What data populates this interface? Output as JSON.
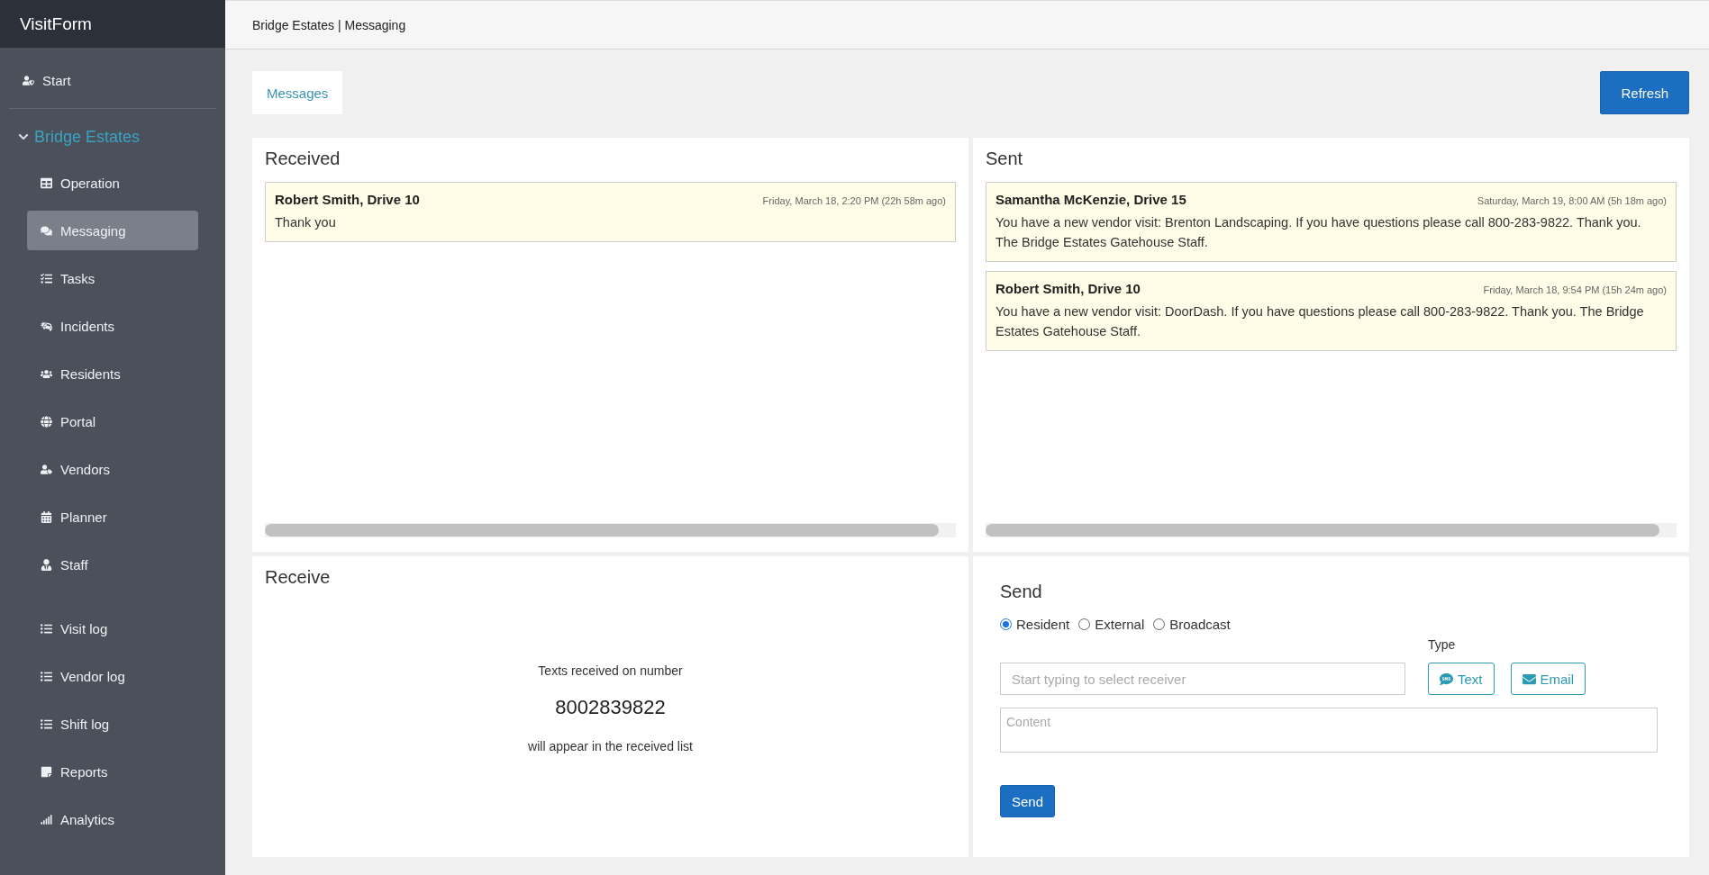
{
  "sidebar": {
    "brand": "VisitForm",
    "start_item": {
      "label": "Start",
      "selected": false
    },
    "group": {
      "label": "Bridge Estates",
      "expanded": true,
      "items": [
        {
          "label": "Operation",
          "selected": false
        },
        {
          "label": "Messaging",
          "selected": true
        },
        {
          "label": "Tasks",
          "selected": false
        },
        {
          "label": "Incidents",
          "selected": false
        },
        {
          "label": "Residents",
          "selected": false
        },
        {
          "label": "Portal",
          "selected": false
        },
        {
          "label": "Vendors",
          "selected": false
        },
        {
          "label": "Planner",
          "selected": false
        },
        {
          "label": "Staff",
          "selected": false
        }
      ],
      "log_items": [
        {
          "label": "Visit log",
          "selected": false
        },
        {
          "label": "Vendor log",
          "selected": false
        },
        {
          "label": "Shift log",
          "selected": false
        },
        {
          "label": "Reports",
          "selected": false
        },
        {
          "label": "Analytics",
          "selected": false
        }
      ]
    }
  },
  "header": {
    "breadcrumb": "Bridge Estates | Messaging"
  },
  "tabs": [
    {
      "label": "Messages",
      "selected": true
    }
  ],
  "refresh_button": "Refresh",
  "received": {
    "title": "Received",
    "messages": [
      {
        "sender": "Robert Smith, Drive 10",
        "time": "Friday, March 18, 2:20 PM (22h 58m ago)",
        "body": "Thank you"
      }
    ]
  },
  "sent": {
    "title": "Sent",
    "messages": [
      {
        "sender": "Samantha McKenzie, Drive 15",
        "time": "Saturday, March 19, 8:00 AM (5h 18m ago)",
        "body": "You have a new vendor visit: Brenton Landscaping. If you have questions please call 800-283-9822. Thank you. The Bridge Estates Gatehouse Staff."
      },
      {
        "sender": "Robert Smith, Drive 10",
        "time": "Friday, March 18, 9:54 PM (15h 24m ago)",
        "body": "You have a new vendor visit: DoorDash. If you have questions please call 800-283-9822. Thank you. The Bridge Estates Gatehouse Staff."
      }
    ]
  },
  "receive": {
    "title": "Receive",
    "line_1": "Texts received on number",
    "number": "8002839822",
    "line_2": "will appear in the received list"
  },
  "send": {
    "title": "Send",
    "recipient_types": [
      {
        "label": "Resident",
        "selected": true
      },
      {
        "label": "External",
        "selected": false
      },
      {
        "label": "Broadcast",
        "selected": false
      }
    ],
    "type_label": "Type",
    "receiver": {
      "placeholder": "Start typing to select receiver"
    },
    "type_buttons": [
      {
        "kind": "text",
        "label": "Text"
      },
      {
        "kind": "email",
        "label": "Email"
      }
    ],
    "content": {
      "placeholder": "Content"
    },
    "send_button": "Send"
  }
}
